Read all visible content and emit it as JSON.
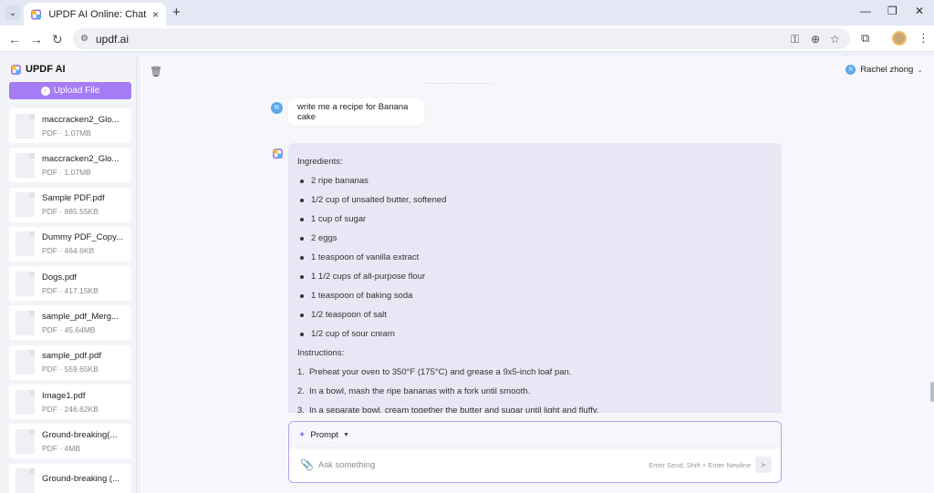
{
  "browser": {
    "tab_title": "UPDF AI Online: Chat with PDF",
    "tab_close": "×",
    "new_tab": "+",
    "url": "updf.ai",
    "controls": {
      "minimize": "—",
      "restore": "❐",
      "close": "✕"
    },
    "nav": {
      "back": "←",
      "forward": "→",
      "reload": "↻"
    }
  },
  "sidebar": {
    "brand": "UPDF AI",
    "upload_label": "Upload File",
    "files": [
      {
        "name": "maccracken2_Glo...",
        "meta": "PDF · 1.07MB"
      },
      {
        "name": "maccracken2_Glo...",
        "meta": "PDF · 1.07MB"
      },
      {
        "name": "Sample PDF.pdf",
        "meta": "PDF · 885.55KB"
      },
      {
        "name": "Dummy PDF_Copy...",
        "meta": "PDF · 464.6KB"
      },
      {
        "name": "Dogs.pdf",
        "meta": "PDF · 417.15KB"
      },
      {
        "name": "sample_pdf_Merg...",
        "meta": "PDF · 45.64MB"
      },
      {
        "name": "sample_pdf.pdf",
        "meta": "PDF · 559.65KB"
      },
      {
        "name": "Image1.pdf",
        "meta": "PDF · 246.62KB"
      },
      {
        "name": "Ground-breaking(...",
        "meta": "PDF · 4MB"
      },
      {
        "name": "Ground-breaking (...",
        "meta": ""
      }
    ]
  },
  "header": {
    "user_initial": "R",
    "user_name": "Rachel zhong"
  },
  "chat": {
    "user_initial": "R",
    "user_message": "write me a recipe for Banana cake",
    "ingredients_heading": "Ingredients:",
    "ingredients": [
      "2 ripe bananas",
      "1/2 cup of unsalted butter, softened",
      "1 cup of sugar",
      "2 eggs",
      "1 teaspoon of vanilla extract",
      "1 1/2 cups of all-purpose flour",
      "1 teaspoon of baking soda",
      "1/2 teaspoon of salt",
      "1/2 cup of sour cream"
    ],
    "instructions_heading": "Instructions:",
    "instructions": [
      {
        "num": "1.",
        "text": "Preheat your oven to 350°F (175°C) and grease a 9x5-inch loaf pan."
      },
      {
        "num": "2.",
        "text": "In a bowl, mash the ripe bananas with a fork until smooth."
      },
      {
        "num": "3.",
        "text": "In a separate bowl, cream together the butter and sugar until light and fluffy."
      }
    ]
  },
  "composer": {
    "mode_label": "Prompt",
    "placeholder": "Ask something",
    "value": "",
    "hint": "Enter Send; Shift + Enter Newline"
  },
  "colors": {
    "accent": "#a47cf3",
    "ai_bubble": "#e9e7f6",
    "avatar": "#5aa8e6"
  }
}
